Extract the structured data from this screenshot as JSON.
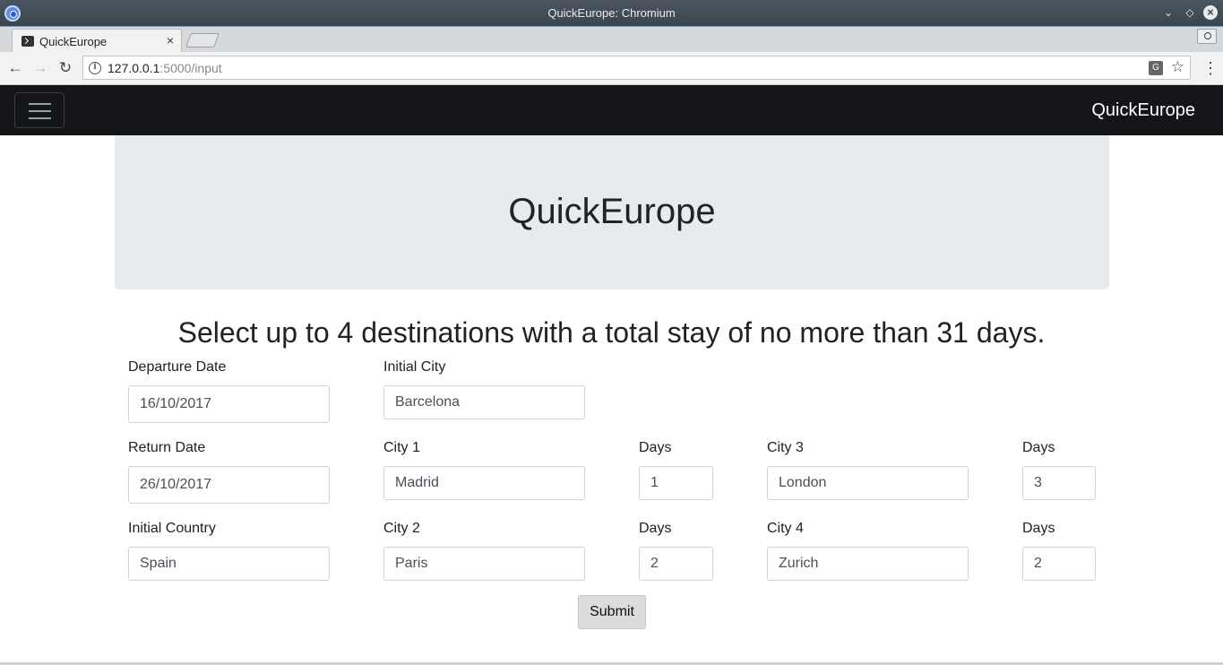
{
  "window": {
    "title": "QuickEurope: Chromium"
  },
  "tab": {
    "title": "QuickEurope",
    "close_glyph": "×"
  },
  "address_bar": {
    "host": "127.0.0.1",
    "path": ":5000/input"
  },
  "navbar": {
    "brand": "QuickEurope"
  },
  "jumbotron": {
    "title": "QuickEurope"
  },
  "instructions": "Select up to 4 destinations with a total stay of no more than 31 days.",
  "form": {
    "departure_date": {
      "label": "Departure Date",
      "value": "16/10/2017"
    },
    "return_date": {
      "label": "Return Date",
      "value": "26/10/2017"
    },
    "initial_country": {
      "label": "Initial Country",
      "value": "Spain"
    },
    "initial_city": {
      "label": "Initial City",
      "value": "Barcelona"
    },
    "city1": {
      "label": "City 1",
      "value": "Madrid",
      "days_label": "Days",
      "days": "1"
    },
    "city2": {
      "label": "City 2",
      "value": "Paris",
      "days_label": "Days",
      "days": "2"
    },
    "city3": {
      "label": "City 3",
      "value": "London",
      "days_label": "Days",
      "days": "3"
    },
    "city4": {
      "label": "City 4",
      "value": "Zurich",
      "days_label": "Days",
      "days": "2"
    },
    "submit_label": "Submit"
  }
}
